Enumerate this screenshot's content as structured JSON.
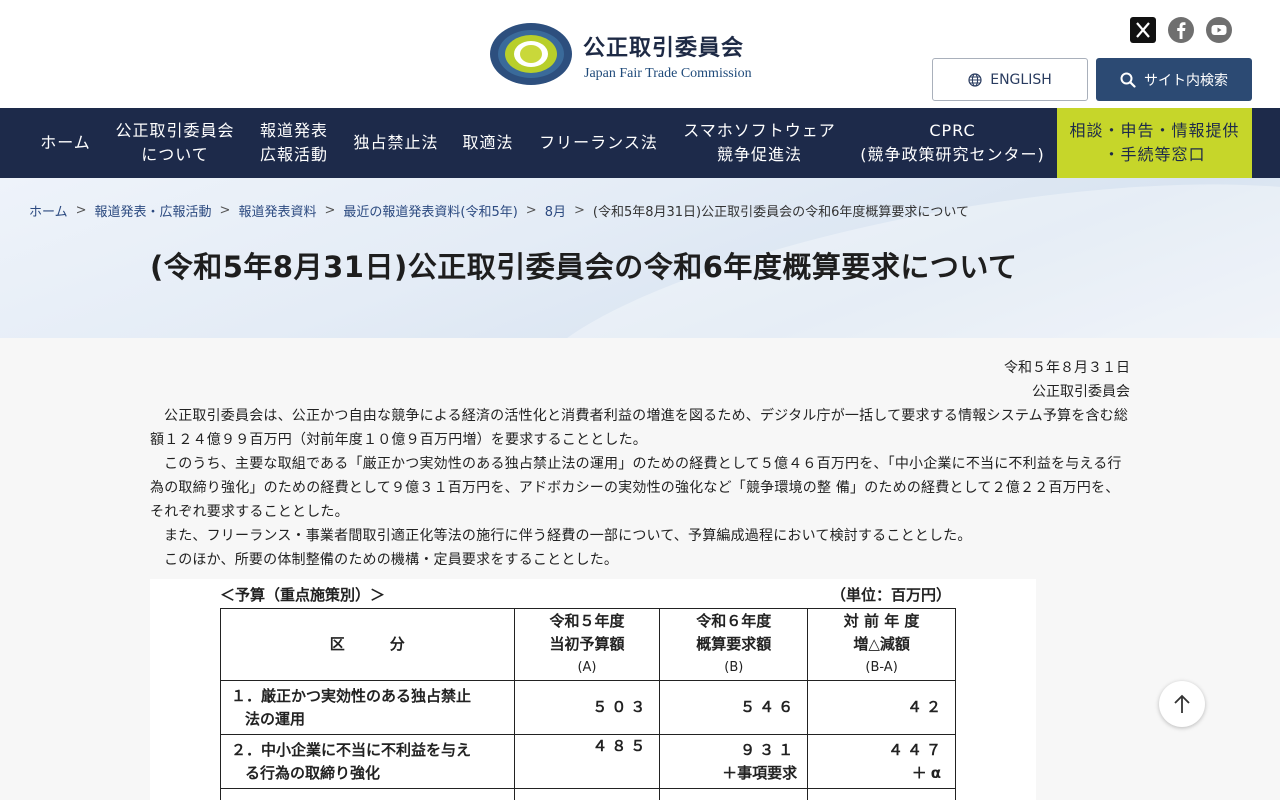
{
  "header": {
    "org_name_ja": "公正取引委員会",
    "org_name_en": "Japan Fair Trade Commission",
    "logo_ring_text": "JAPAN FAIR TRADE COMMISSION",
    "english_button": "ENGLISH",
    "search_button": "サイト内検索",
    "social": [
      "x-icon",
      "facebook-icon",
      "youtube-icon"
    ]
  },
  "nav": {
    "items": [
      {
        "l1": "ホーム",
        "l2": ""
      },
      {
        "l1": "公正取引委員会",
        "l2": "について"
      },
      {
        "l1": "報道発表",
        "l2": "広報活動"
      },
      {
        "l1": "独占禁止法",
        "l2": ""
      },
      {
        "l1": "取適法",
        "l2": ""
      },
      {
        "l1": "フリーランス法",
        "l2": ""
      },
      {
        "l1": "スマホソフトウェア",
        "l2": "競争促進法"
      },
      {
        "l1": "CPRC",
        "l2": "(競争政策研究センター)"
      },
      {
        "l1": "相談・申告・情報提供",
        "l2": "・手続等窓口"
      }
    ]
  },
  "breadcrumb": {
    "items": [
      "ホーム",
      "報道発表・広報活動",
      "報道発表資料",
      "最近の報道発表資料(令和5年)",
      "8月"
    ],
    "current": "(令和5年8月31日)公正取引委員会の令和6年度概算要求について",
    "separator": ">"
  },
  "page_title": "(令和5年8月31日)公正取引委員会の令和6年度概算要求について",
  "main": {
    "date": "令和５年８月３１日",
    "issuer": "公正取引委員会",
    "paragraphs": [
      "公正取引委員会は、公正かつ自由な競争による経済の活性化と消費者利益の増進を図るため、デジタル庁が一括して要求する情報システム予算を含む総額１２４億９９百万円（対前年度１０億９百万円増）を要求することとした。",
      "このうち、主要な取組である「厳正かつ実効性のある独占禁止法の運用」のための経費として５億４６百万円を、「中小企業に不当に不利益を与える行為の取締り強化」のための経費として９億３１百万円を、アドボカシーの実効性の強化など「競争環境の整 備」のための経費として２億２２百万円を、それぞれ要求することとした。",
      "また、フリーランス・事業者間取引適正化等法の施行に伴う経費の一部について、予算編成過程において検討することとした。",
      "このほか、所要の体制整備のための機構・定員要求をすることとした。"
    ]
  },
  "budget_table": {
    "caption_left": "＜予算（重点施策別）＞",
    "caption_right": "（単位：百万円）",
    "headers": [
      {
        "l1": "区　　　分",
        "l2": "",
        "l3": ""
      },
      {
        "l1": "令和５年度",
        "l2": "当初予算額",
        "l3": "(A)"
      },
      {
        "l1": "令和６年度",
        "l2": "概算要求額",
        "l3": "(B)"
      },
      {
        "l1": "対 前 年 度",
        "l2": "増△減額",
        "l3": "(B-A)"
      }
    ],
    "rows": [
      {
        "item_l1": "１．厳正かつ実効性のある独占禁止",
        "item_l2": "法の運用",
        "a": "５０３",
        "b": "５４６",
        "b2": "",
        "d": "４２",
        "d2": ""
      },
      {
        "item_l1": "２．中小企業に不当に不利益を与え",
        "item_l2": "る行為の取締り強化",
        "a": "４８５",
        "b": "９３１",
        "b2": "＋事項要求",
        "d": "４４７",
        "d2": "＋α"
      }
    ]
  },
  "back_to_top_icon": "arrow-up-icon"
}
